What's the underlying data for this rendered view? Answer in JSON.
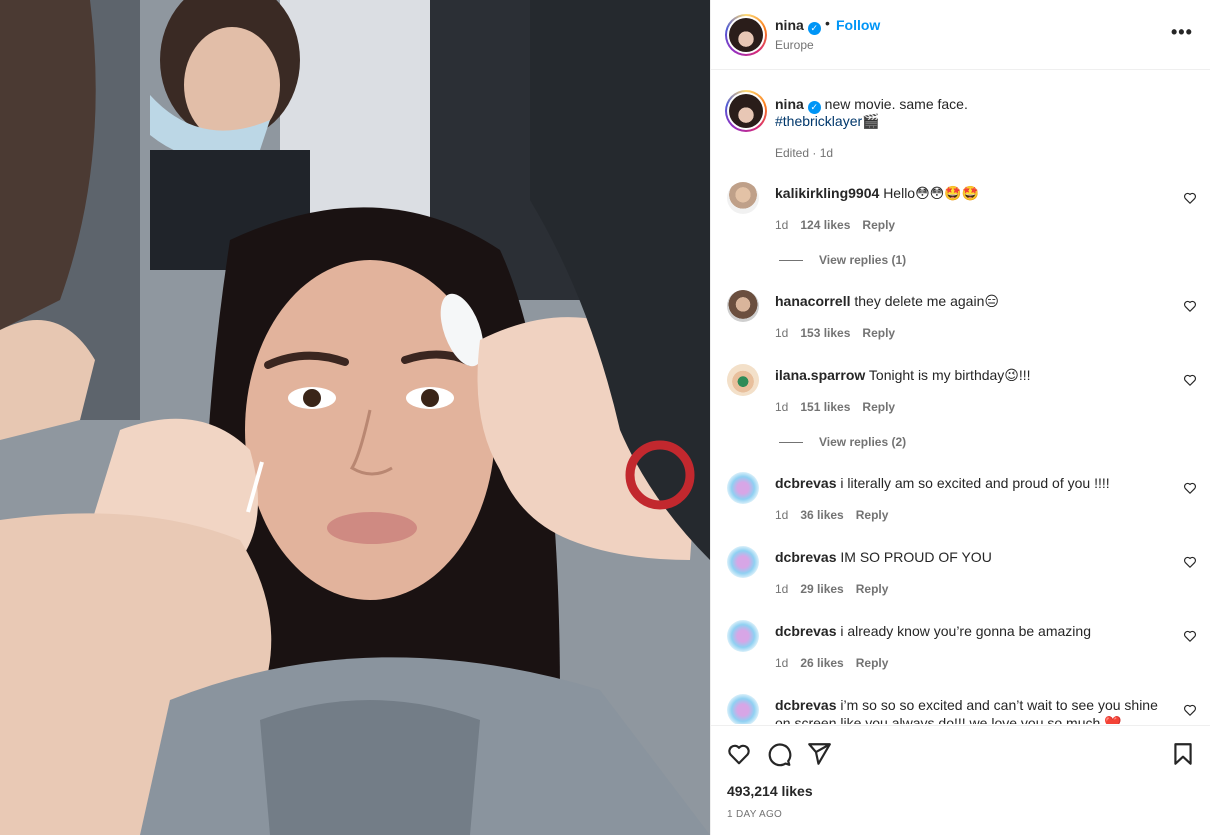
{
  "post": {
    "username": "nina",
    "verified": true,
    "follow_label": "Follow",
    "separator": "•",
    "location": "Europe",
    "more_label": "•••",
    "caption": {
      "text": "new movie. same face.",
      "hashtag": "#thebricklayer🎬",
      "edited": "Edited · 1d"
    },
    "likes": "493,214 likes",
    "time_ago": "1 DAY AGO"
  },
  "comments": [
    {
      "username": "kalikirkling9904",
      "text": "Hello😳😳🤩🤩",
      "age": "1d",
      "likes": "124 likes",
      "reply": "Reply",
      "view_replies": "View replies (1)",
      "avatar": "photo"
    },
    {
      "username": "hanacorrell",
      "text": "they delete me again😑",
      "age": "1d",
      "likes": "153 likes",
      "reply": "Reply",
      "avatar": "photo"
    },
    {
      "username": "ilana.sparrow",
      "text": "Tonight is my birthday😉!!!",
      "age": "1d",
      "likes": "151 likes",
      "reply": "Reply",
      "view_replies": "View replies (2)",
      "avatar": "photo"
    },
    {
      "username": "dcbrevas",
      "text": "i literally am so excited and proud of you !!!!",
      "age": "1d",
      "likes": "36 likes",
      "reply": "Reply",
      "avatar": "gradient"
    },
    {
      "username": "dcbrevas",
      "text": "IM SO PROUD OF YOU",
      "age": "1d",
      "likes": "29 likes",
      "reply": "Reply",
      "avatar": "gradient"
    },
    {
      "username": "dcbrevas",
      "text": "i already know you’re gonna be amazing",
      "age": "1d",
      "likes": "26 likes",
      "reply": "Reply",
      "avatar": "gradient"
    },
    {
      "username": "dcbrevas",
      "text": "i’m so so so excited and can’t wait to see you shine on screen like you always do!!! we love you so much ❤️",
      "avatar": "gradient"
    }
  ],
  "icons": {
    "like": "heart-icon",
    "comment": "comment-icon",
    "share": "share-icon",
    "save": "bookmark-icon",
    "more": "more-options-icon",
    "verified": "verified-badge-icon"
  },
  "colors": {
    "accent": "#0095f6",
    "text": "#262626",
    "muted": "#737373",
    "hashtag": "#00376b",
    "divider": "#efefef"
  }
}
